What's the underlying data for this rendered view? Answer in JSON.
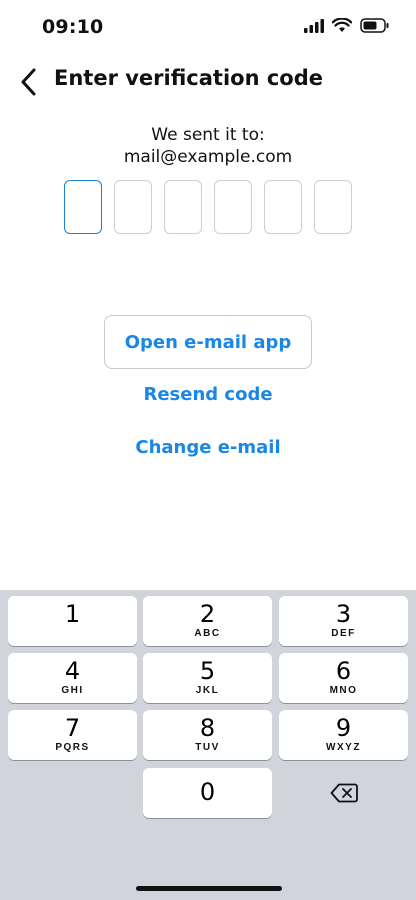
{
  "status": {
    "time": "09:10"
  },
  "header": {
    "title": "Enter verification code"
  },
  "info": {
    "line1": "We sent it to:",
    "email": "mail@example.com"
  },
  "code": {
    "boxes": [
      "",
      "",
      "",
      "",
      "",
      ""
    ]
  },
  "actions": {
    "open_email": "Open e-mail app",
    "resend": "Resend code",
    "change_email": "Change e-mail"
  },
  "colors": {
    "accent": "#1a86e6",
    "active_border": "#1b7fd6",
    "keyboard_bg": "#d1d4db"
  },
  "keypad": {
    "keys": [
      {
        "num": "1",
        "letters": ""
      },
      {
        "num": "2",
        "letters": "ABC"
      },
      {
        "num": "3",
        "letters": "DEF"
      },
      {
        "num": "4",
        "letters": "GHI"
      },
      {
        "num": "5",
        "letters": "JKL"
      },
      {
        "num": "6",
        "letters": "MNO"
      },
      {
        "num": "7",
        "letters": "PQRS"
      },
      {
        "num": "8",
        "letters": "TUV"
      },
      {
        "num": "9",
        "letters": "WXYZ"
      },
      {
        "num": "0",
        "letters": ""
      }
    ],
    "delete_icon": "backspace-icon"
  }
}
